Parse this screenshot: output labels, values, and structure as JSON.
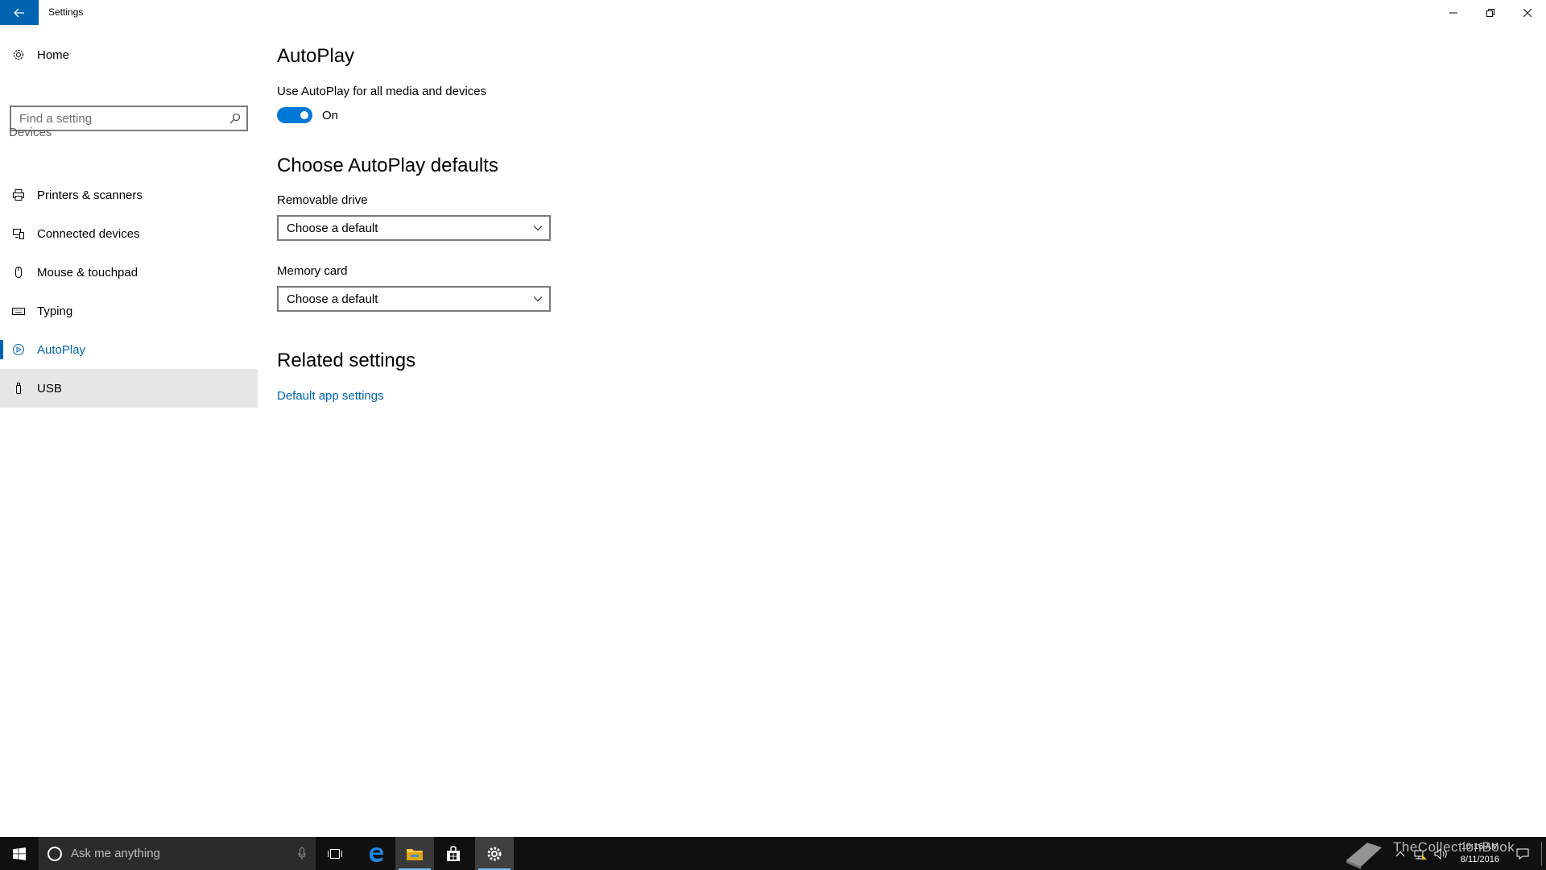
{
  "window": {
    "title": "Settings"
  },
  "sidebar": {
    "home_label": "Home",
    "search_placeholder": "Find a setting",
    "group_label": "Devices",
    "items": [
      {
        "label": "Printers & scanners",
        "icon": "printer-icon"
      },
      {
        "label": "Connected devices",
        "icon": "connected-devices-icon"
      },
      {
        "label": "Mouse & touchpad",
        "icon": "mouse-icon"
      },
      {
        "label": "Typing",
        "icon": "keyboard-icon"
      },
      {
        "label": "AutoPlay",
        "icon": "autoplay-icon",
        "selected": true
      },
      {
        "label": "USB",
        "icon": "usb-icon",
        "hovered": true
      }
    ]
  },
  "main": {
    "autoplay_heading": "AutoPlay",
    "autoplay_toggle_label": "Use AutoPlay for all media and devices",
    "autoplay_toggle_state": "On",
    "defaults_heading": "Choose AutoPlay defaults",
    "removable_drive_label": "Removable drive",
    "removable_drive_value": "Choose a default",
    "memory_card_label": "Memory card",
    "memory_card_value": "Choose a default",
    "related_heading": "Related settings",
    "related_link": "Default app settings"
  },
  "taskbar": {
    "search_placeholder": "Ask me anything",
    "time": "10:16 AM",
    "date": "8/11/2016",
    "watermark": "TheCollectionBook"
  },
  "colors": {
    "accent": "#0063b1",
    "toggle_on": "#0078d7",
    "taskbar": "#101010"
  }
}
